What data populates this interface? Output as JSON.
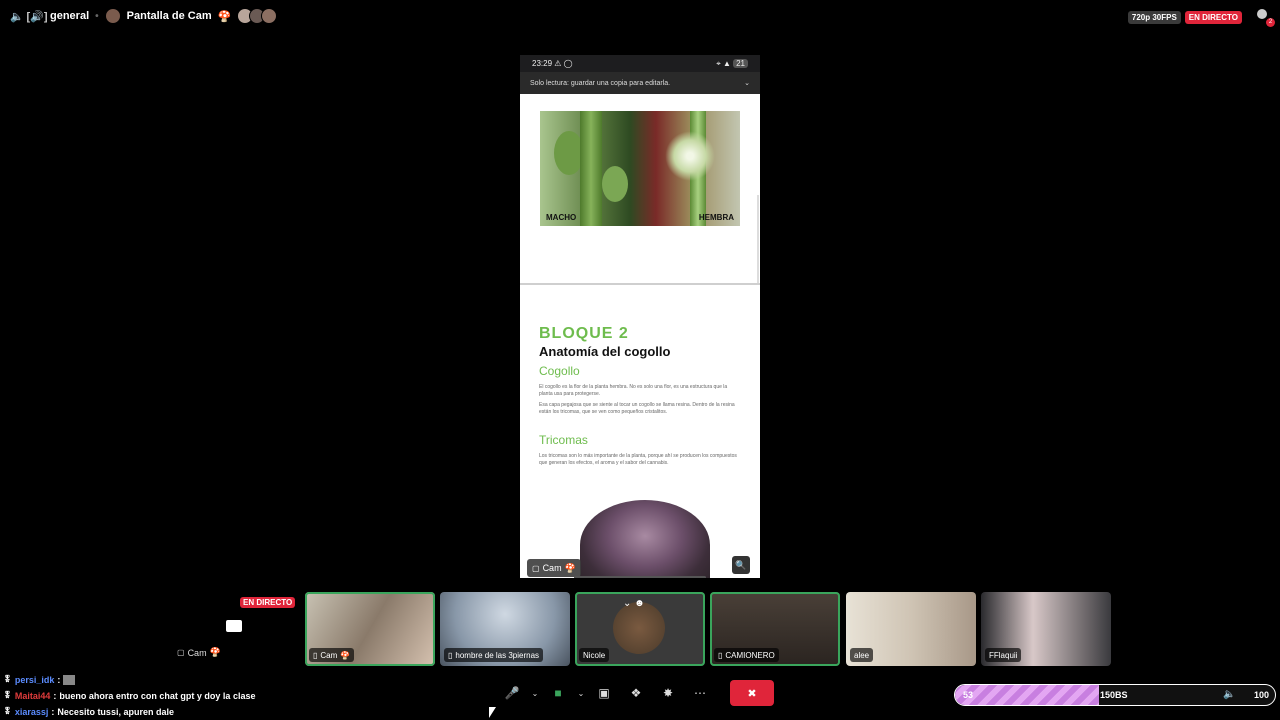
{
  "topbar": {
    "channel_name": "general",
    "stream_title": "Pantalla de Cam",
    "stream_title_emoji": "🍄",
    "quality": "720p 30FPS",
    "live": "EN DIRECTO",
    "viewer_count": "2"
  },
  "phone": {
    "time": "23:29",
    "battery": "21",
    "notice": "Solo lectura: guardar una copia para editarla.",
    "image_label_left": "MACHO",
    "image_label_right": "HEMBRA",
    "block_title": "BLOQUE 2",
    "block_subtitle": "Anatomía del cogollo",
    "section1_title": "Cogollo",
    "section1_p1": "El cogollo es la flor de la planta hembra. No es solo una flor, es una estructura que la planta usa para protegerse.",
    "section1_p2": "Esa capa pegajosa que se siente al tocar un cogollo se llama resina. Dentro de la resina están los tricomas, que se ven como pequeños cristalitos.",
    "section2_title": "Tricomas",
    "section2_p1": "Los tricomas son lo más importante de la planta, porque ahí se producen los compuestos que generan los efectos, el aroma y el sabor del cannabis.",
    "presenter_label": "Cam",
    "presenter_emoji": "🍄"
  },
  "self": {
    "live": "EN DIRECTO",
    "label": "Cam",
    "emoji": "🍄"
  },
  "participants": [
    {
      "name": "Cam",
      "emoji": "🍄",
      "speaking": true
    },
    {
      "name": "hombre de las 3piernas",
      "speaking": false
    },
    {
      "name": "Nicole",
      "speaking": true
    },
    {
      "name": "CAMIONERO",
      "speaking": true
    },
    {
      "name": "alee",
      "speaking": false
    },
    {
      "name": "FFlaquii",
      "speaking": false
    }
  ],
  "chat": [
    {
      "user": "persi_idk",
      "user_color": "#5b8cff",
      "message": ""
    },
    {
      "user": "Maitai44",
      "user_color": "#e03c3c",
      "message": "bueno ahora entro con chat gpt y doy la clase"
    },
    {
      "user": "xiarassj",
      "user_color": "#5b8cff",
      "message": "Necesito tussi, apuren dale"
    }
  ],
  "stream_bar": {
    "left_value": "53",
    "mid_label": "150BS",
    "right_value": "100",
    "fill_fraction": 0.45
  },
  "colors": {
    "live_red": "#e0253a",
    "speaking_green": "#3aa55c",
    "doc_green": "#6ebc4d"
  }
}
